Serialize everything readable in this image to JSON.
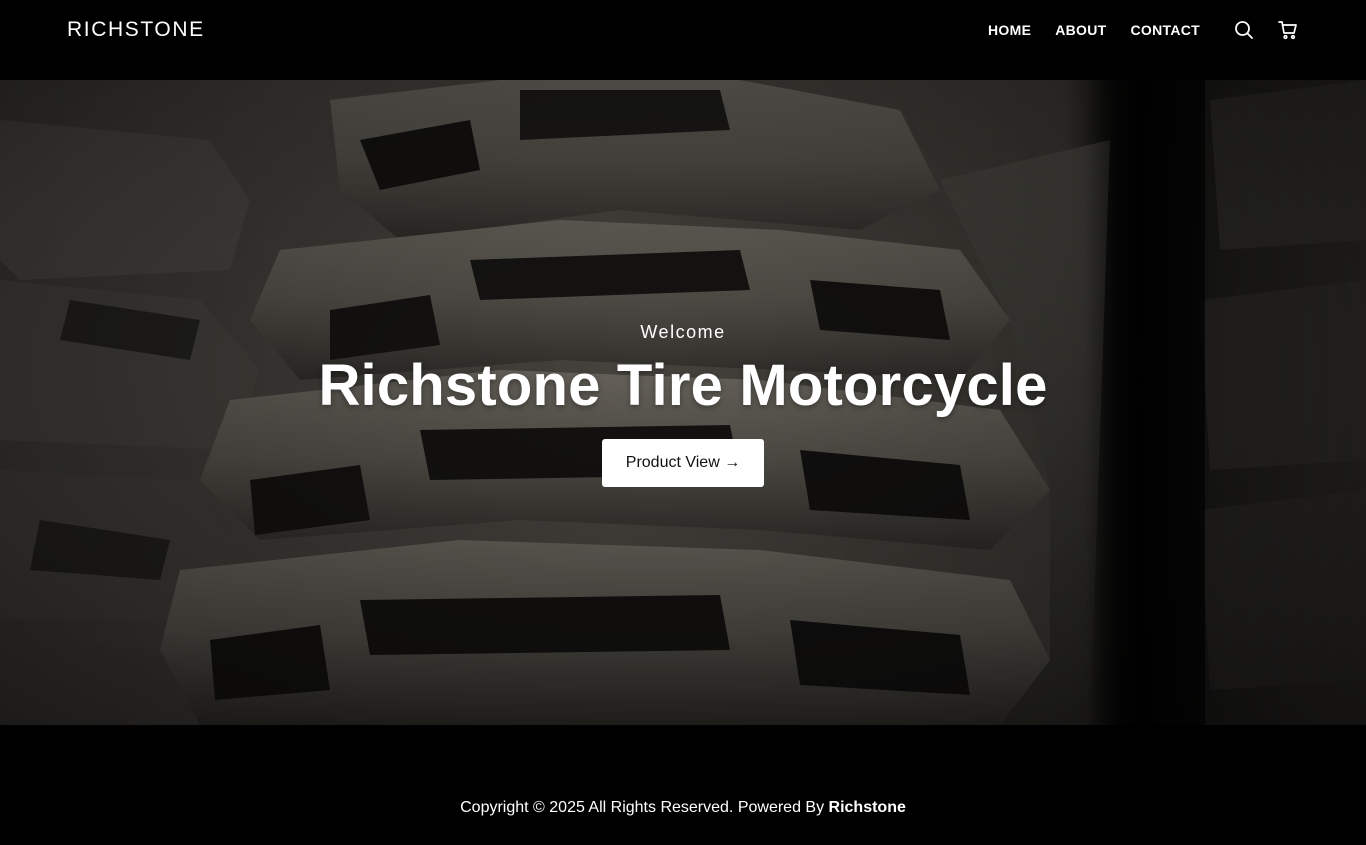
{
  "header": {
    "logo": "RICHSTONE",
    "nav": [
      {
        "label": "HOME"
      },
      {
        "label": "ABOUT"
      },
      {
        "label": "CONTACT"
      }
    ],
    "icons": [
      "search-icon",
      "cart-icon"
    ]
  },
  "hero": {
    "welcome": "Welcome",
    "title": "Richstone Tire Motorcycle",
    "button_label": "Product View →"
  },
  "footer": {
    "copyright_text": "Copyright © 2025 All Rights Reserved. Powered By ",
    "brand": "Richstone"
  },
  "colors": {
    "header_bg": "#000000",
    "button_bg": "#ffffff",
    "text": "#ffffff"
  }
}
